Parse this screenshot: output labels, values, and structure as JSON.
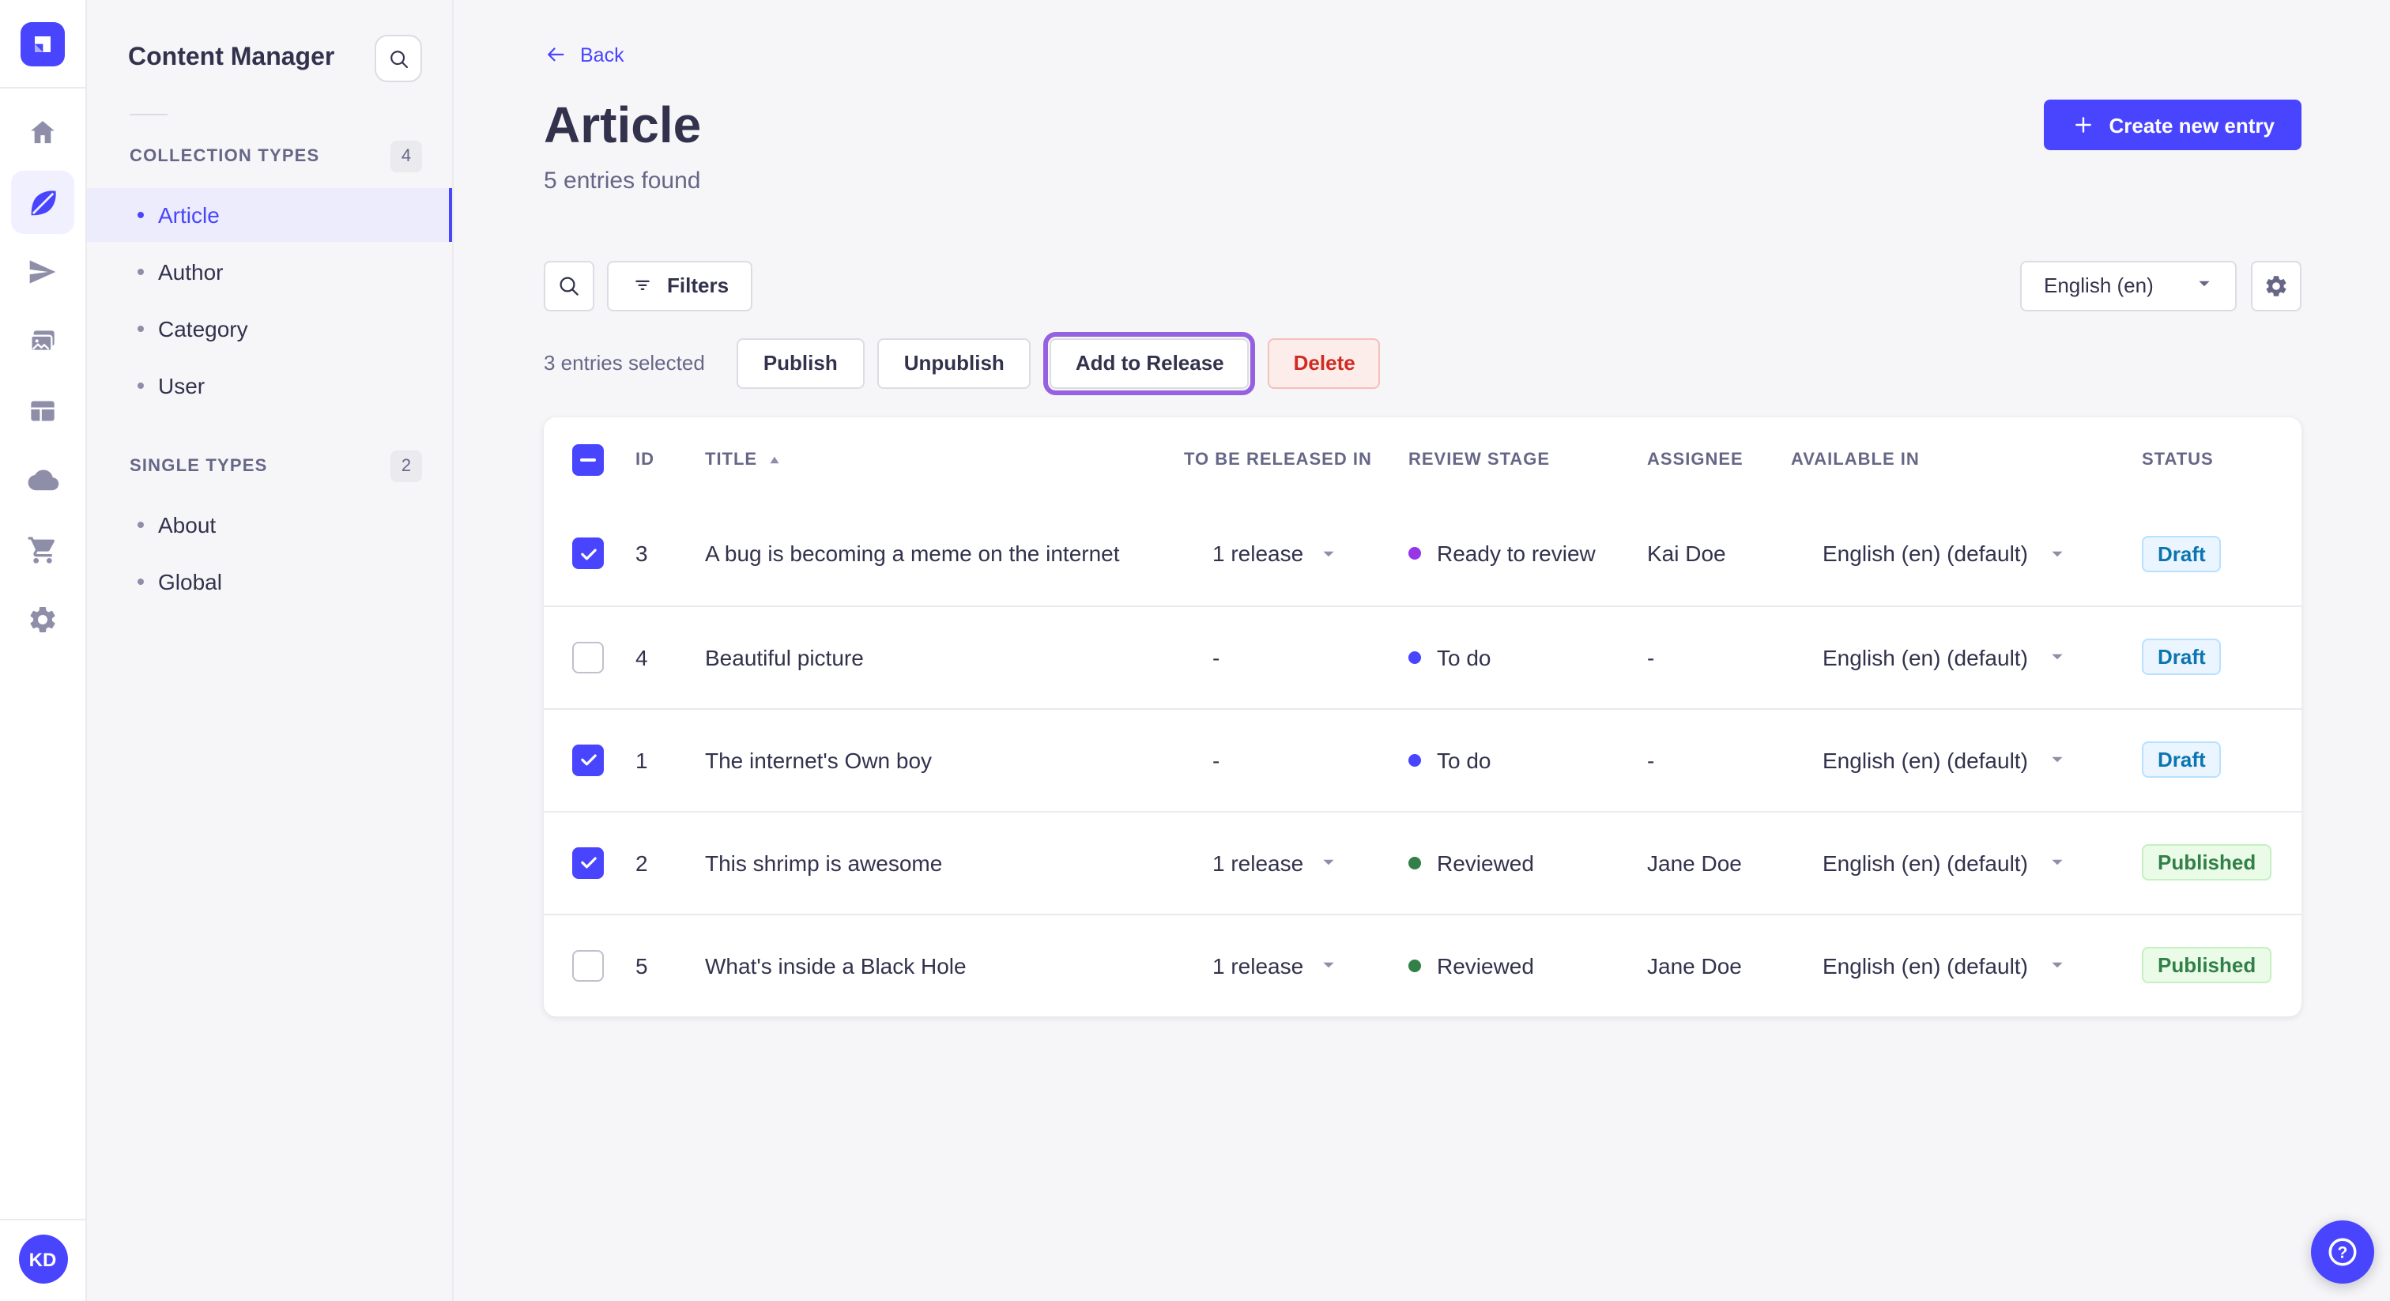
{
  "nav_rail": {
    "logo_icon": "strapi-logo",
    "items": [
      {
        "icon": "home-icon"
      },
      {
        "icon": "content-icon",
        "active": true
      },
      {
        "icon": "send-icon"
      },
      {
        "icon": "media-icon"
      },
      {
        "icon": "layout-icon"
      },
      {
        "icon": "cloud-icon"
      },
      {
        "icon": "cart-icon"
      },
      {
        "icon": "settings-icon"
      }
    ],
    "avatar_initials": "KD"
  },
  "sidebar": {
    "title": "Content Manager",
    "search_icon": "search-icon",
    "sections": [
      {
        "label": "COLLECTION TYPES",
        "count": "4",
        "items": [
          {
            "label": "Article",
            "active": true
          },
          {
            "label": "Author"
          },
          {
            "label": "Category"
          },
          {
            "label": "User"
          }
        ]
      },
      {
        "label": "SINGLE TYPES",
        "count": "2",
        "items": [
          {
            "label": "About"
          },
          {
            "label": "Global"
          }
        ]
      }
    ]
  },
  "header": {
    "back_label": "Back",
    "back_icon": "arrow-left-icon",
    "title": "Article",
    "subtitle": "5 entries found",
    "create_button": "Create new entry",
    "create_icon": "plus-icon"
  },
  "toolbar": {
    "search_icon": "search-icon",
    "filters_label": "Filters",
    "filters_icon": "filter-icon",
    "locale_value": "English (en)",
    "locale_chevron_icon": "chevron-down-icon",
    "settings_icon": "gear-icon"
  },
  "selection_bar": {
    "selected_text": "3 entries selected",
    "publish_label": "Publish",
    "unpublish_label": "Unpublish",
    "add_to_release_label": "Add to Release",
    "delete_label": "Delete",
    "add_to_release_highlight_color": "#9661e0"
  },
  "table": {
    "columns": [
      "ID",
      "TITLE",
      "TO BE RELEASED IN",
      "REVIEW STAGE",
      "ASSIGNEE",
      "AVAILABLE IN",
      "STATUS"
    ],
    "sort_column": "TITLE",
    "sort_icon": "sort-asc-icon",
    "rows": [
      {
        "checked": true,
        "id": "3",
        "title": "A bug is becoming a meme on the internet",
        "release": "1 release",
        "stage": "Ready to review",
        "stage_color": "#9736e8",
        "assignee": "Kai Doe",
        "locale": "English (en) (default)",
        "status": "Draft"
      },
      {
        "checked": false,
        "id": "4",
        "title": "Beautiful picture",
        "release": "-",
        "stage": "To do",
        "stage_color": "#4945ff",
        "assignee": "-",
        "locale": "English (en) (default)",
        "status": "Draft"
      },
      {
        "checked": true,
        "id": "1",
        "title": "The internet's Own boy",
        "release": "-",
        "stage": "To do",
        "stage_color": "#4945ff",
        "assignee": "-",
        "locale": "English (en) (default)",
        "status": "Draft"
      },
      {
        "checked": true,
        "id": "2",
        "title": "This shrimp is awesome",
        "release": "1 release",
        "stage": "Reviewed",
        "stage_color": "#328048",
        "assignee": "Jane Doe",
        "locale": "English (en) (default)",
        "status": "Published"
      },
      {
        "checked": false,
        "id": "5",
        "title": "What's inside a Black Hole",
        "release": "1 release",
        "stage": "Reviewed",
        "stage_color": "#328048",
        "assignee": "Jane Doe",
        "locale": "English (en) (default)",
        "status": "Published"
      }
    ]
  },
  "colors": {
    "accent": "#4945ff",
    "accent_light_bg": "#f0f0ff",
    "page_bg": "#f6f6f9",
    "border": "#eaeaef",
    "text": "#32324d",
    "text_muted": "#666687",
    "draft_badge": {
      "bg": "#eaf5ff",
      "border": "#b8e1ff",
      "text": "#0c75af"
    },
    "published_badge": {
      "bg": "#eafbe7",
      "border": "#c6f0c2",
      "text": "#328048"
    },
    "delete_button": {
      "bg": "#fcecea",
      "border": "#f5c0b8",
      "text": "#d02b20"
    }
  },
  "help_icon": "question-mark-icon"
}
